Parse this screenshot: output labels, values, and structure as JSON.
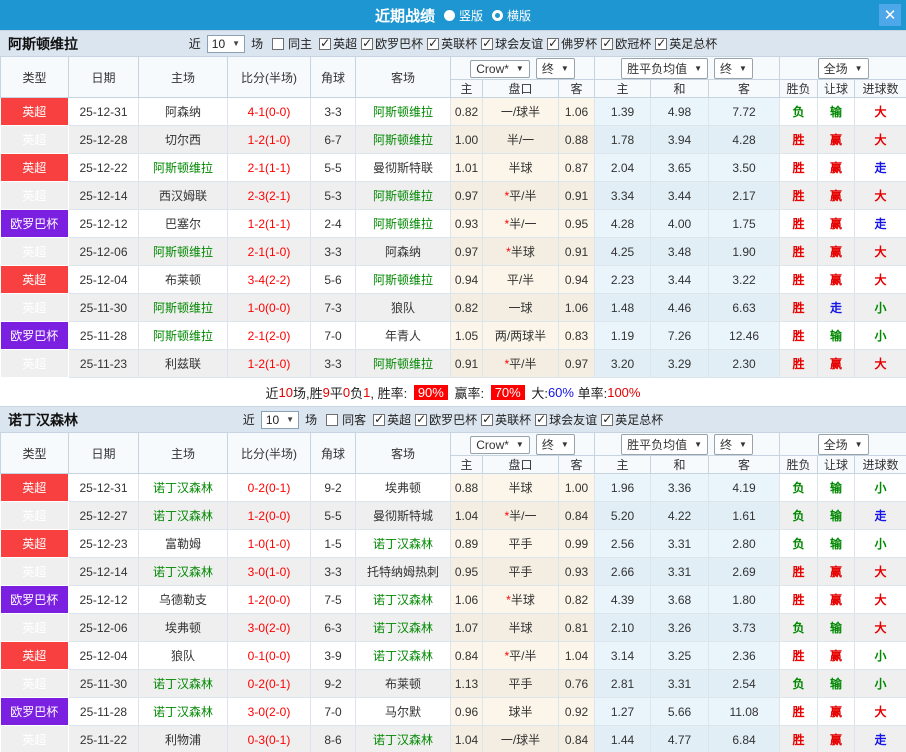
{
  "titlebar": {
    "title": "近期战绩",
    "modes": [
      {
        "label": "竖版",
        "selected": false
      },
      {
        "label": "横版",
        "selected": true
      }
    ],
    "close_icon": "✕"
  },
  "colors": {
    "titlebar_blue": "#1e96d2",
    "epl_badge_red": "#f84040",
    "europa_badge_purple": "#7b1fe0",
    "team_highlight_green": "#008800",
    "score_red": "#ff0000",
    "win_red": "#e60000",
    "lose_green": "#008800",
    "draw_blue": "#1414e6",
    "rate_badge_red": "#ff0000"
  },
  "table_header": {
    "cols": [
      "类型",
      "日期",
      "主场",
      "比分(半场)",
      "角球",
      "客场"
    ],
    "bookmaker": "Crow*",
    "final1": "终",
    "avg_label": "胜平负均值",
    "final2": "终",
    "scope": "全场",
    "sub": [
      "主",
      "盘口",
      "客",
      "主",
      "和",
      "客",
      "胜负",
      "让球",
      "进球数"
    ]
  },
  "sections": [
    {
      "team": "阿斯顿维拉",
      "filter": {
        "near_label": "近",
        "count": "10",
        "unit_label": "场",
        "same_label": "同主",
        "same_checked": false,
        "leagues": [
          {
            "label": "英超",
            "checked": true
          },
          {
            "label": "欧罗巴杯",
            "checked": true
          },
          {
            "label": "英联杯",
            "checked": true
          },
          {
            "label": "球会友谊",
            "checked": true
          },
          {
            "label": "佛罗杯",
            "checked": true
          },
          {
            "label": "欧冠杯",
            "checked": true
          },
          {
            "label": "英足总杯",
            "checked": true
          }
        ]
      },
      "rows": [
        {
          "league": "英超",
          "lg": "red",
          "date": "25-12-31",
          "home": "阿森纳",
          "home_hl": false,
          "score": "4-1(0-0)",
          "corner": "3-3",
          "away": "阿斯顿维拉",
          "away_hl": true,
          "h": "0.82",
          "star": false,
          "hcap": "一/球半",
          "a": "1.06",
          "m1": "1.39",
          "m2": "4.98",
          "m3": "7.72",
          "r1": "负",
          "c1": "green",
          "r2": "输",
          "c2": "green",
          "r3": "大",
          "c3": "red"
        },
        {
          "league": "英超",
          "lg": "red",
          "date": "25-12-28",
          "home": "切尔西",
          "home_hl": false,
          "score": "1-2(1-0)",
          "corner": "6-7",
          "away": "阿斯顿维拉",
          "away_hl": true,
          "h": "1.00",
          "star": false,
          "hcap": "半/一",
          "a": "0.88",
          "m1": "1.78",
          "m2": "3.94",
          "m3": "4.28",
          "r1": "胜",
          "c1": "red",
          "r2": "赢",
          "c2": "red",
          "r3": "大",
          "c3": "red"
        },
        {
          "league": "英超",
          "lg": "red",
          "date": "25-12-22",
          "home": "阿斯顿维拉",
          "home_hl": true,
          "score": "2-1(1-1)",
          "corner": "5-5",
          "away": "曼彻斯特联",
          "away_hl": false,
          "h": "1.01",
          "star": false,
          "hcap": "半球",
          "a": "0.87",
          "m1": "2.04",
          "m2": "3.65",
          "m3": "3.50",
          "r1": "胜",
          "c1": "red",
          "r2": "赢",
          "c2": "red",
          "r3": "走",
          "c3": "blue"
        },
        {
          "league": "英超",
          "lg": "red",
          "date": "25-12-14",
          "home": "西汉姆联",
          "home_hl": false,
          "score": "2-3(2-1)",
          "corner": "5-3",
          "away": "阿斯顿维拉",
          "away_hl": true,
          "h": "0.97",
          "star": true,
          "hcap": "平/半",
          "a": "0.91",
          "m1": "3.34",
          "m2": "3.44",
          "m3": "2.17",
          "r1": "胜",
          "c1": "red",
          "r2": "赢",
          "c2": "red",
          "r3": "大",
          "c3": "red"
        },
        {
          "league": "欧罗巴杯",
          "lg": "purple",
          "date": "25-12-12",
          "home": "巴塞尔",
          "home_hl": false,
          "score": "1-2(1-1)",
          "corner": "2-4",
          "away": "阿斯顿维拉",
          "away_hl": true,
          "h": "0.93",
          "star": true,
          "hcap": "半/一",
          "a": "0.95",
          "m1": "4.28",
          "m2": "4.00",
          "m3": "1.75",
          "r1": "胜",
          "c1": "red",
          "r2": "赢",
          "c2": "red",
          "r3": "走",
          "c3": "blue"
        },
        {
          "league": "英超",
          "lg": "red",
          "date": "25-12-06",
          "home": "阿斯顿维拉",
          "home_hl": true,
          "score": "2-1(1-0)",
          "corner": "3-3",
          "away": "阿森纳",
          "away_hl": false,
          "h": "0.97",
          "star": true,
          "hcap": "半球",
          "a": "0.91",
          "m1": "4.25",
          "m2": "3.48",
          "m3": "1.90",
          "r1": "胜",
          "c1": "red",
          "r2": "赢",
          "c2": "red",
          "r3": "大",
          "c3": "red"
        },
        {
          "league": "英超",
          "lg": "red",
          "date": "25-12-04",
          "home": "布莱顿",
          "home_hl": false,
          "score": "3-4(2-2)",
          "corner": "5-6",
          "away": "阿斯顿维拉",
          "away_hl": true,
          "h": "0.94",
          "star": false,
          "hcap": "平/半",
          "a": "0.94",
          "m1": "2.23",
          "m2": "3.44",
          "m3": "3.22",
          "r1": "胜",
          "c1": "red",
          "r2": "赢",
          "c2": "red",
          "r3": "大",
          "c3": "red"
        },
        {
          "league": "英超",
          "lg": "red",
          "date": "25-11-30",
          "home": "阿斯顿维拉",
          "home_hl": true,
          "score": "1-0(0-0)",
          "corner": "7-3",
          "away": "狼队",
          "away_hl": false,
          "h": "0.82",
          "star": false,
          "hcap": "一球",
          "a": "1.06",
          "m1": "1.48",
          "m2": "4.46",
          "m3": "6.63",
          "r1": "胜",
          "c1": "red",
          "r2": "走",
          "c2": "blue",
          "r3": "小",
          "c3": "green"
        },
        {
          "league": "欧罗巴杯",
          "lg": "purple",
          "date": "25-11-28",
          "home": "阿斯顿维拉",
          "home_hl": true,
          "score": "2-1(2-0)",
          "corner": "7-0",
          "away": "年青人",
          "away_hl": false,
          "h": "1.05",
          "star": false,
          "hcap": "两/两球半",
          "a": "0.83",
          "m1": "1.19",
          "m2": "7.26",
          "m3": "12.46",
          "r1": "胜",
          "c1": "red",
          "r2": "输",
          "c2": "green",
          "r3": "小",
          "c3": "green"
        },
        {
          "league": "英超",
          "lg": "red",
          "date": "25-11-23",
          "home": "利兹联",
          "home_hl": false,
          "score": "1-2(1-0)",
          "corner": "3-3",
          "away": "阿斯顿维拉",
          "away_hl": true,
          "h": "0.91",
          "star": true,
          "hcap": "平/半",
          "a": "0.97",
          "m1": "3.20",
          "m2": "3.29",
          "m3": "2.30",
          "r1": "胜",
          "c1": "red",
          "r2": "赢",
          "c2": "red",
          "r3": "大",
          "c3": "red"
        }
      ],
      "summary_segments": [
        {
          "t": "近"
        },
        {
          "t": "10",
          "c": "red"
        },
        {
          "t": "场,胜"
        },
        {
          "t": "9",
          "c": "red"
        },
        {
          "t": "平"
        },
        {
          "t": "0",
          "c": "red"
        },
        {
          "t": "负"
        },
        {
          "t": "1",
          "c": "red"
        },
        {
          "t": ", 胜率: "
        },
        {
          "t": "90%",
          "badge": true
        },
        {
          "t": " 赢率: "
        },
        {
          "t": "70%",
          "badge": true
        },
        {
          "t": " 大:"
        },
        {
          "t": "60%",
          "c": "blue"
        },
        {
          "t": " 单率:"
        },
        {
          "t": "100%",
          "c": "red"
        }
      ]
    },
    {
      "team": "诺丁汉森林",
      "filter": {
        "near_label": "近",
        "count": "10",
        "unit_label": "场",
        "same_label": "同客",
        "same_checked": false,
        "leagues": [
          {
            "label": "英超",
            "checked": true
          },
          {
            "label": "欧罗巴杯",
            "checked": true
          },
          {
            "label": "英联杯",
            "checked": true
          },
          {
            "label": "球会友谊",
            "checked": true
          },
          {
            "label": "英足总杯",
            "checked": true
          }
        ]
      },
      "rows": [
        {
          "league": "英超",
          "lg": "red",
          "date": "25-12-31",
          "home": "诺丁汉森林",
          "home_hl": true,
          "score": "0-2(0-1)",
          "corner": "9-2",
          "away": "埃弗顿",
          "away_hl": false,
          "h": "0.88",
          "star": false,
          "hcap": "半球",
          "a": "1.00",
          "m1": "1.96",
          "m2": "3.36",
          "m3": "4.19",
          "r1": "负",
          "c1": "green",
          "r2": "输",
          "c2": "green",
          "r3": "小",
          "c3": "green"
        },
        {
          "league": "英超",
          "lg": "red",
          "date": "25-12-27",
          "home": "诺丁汉森林",
          "home_hl": true,
          "score": "1-2(0-0)",
          "corner": "5-5",
          "away": "曼彻斯特城",
          "away_hl": false,
          "h": "1.04",
          "star": true,
          "hcap": "半/一",
          "a": "0.84",
          "m1": "5.20",
          "m2": "4.22",
          "m3": "1.61",
          "r1": "负",
          "c1": "green",
          "r2": "输",
          "c2": "green",
          "r3": "走",
          "c3": "blue"
        },
        {
          "league": "英超",
          "lg": "red",
          "date": "25-12-23",
          "home": "富勒姆",
          "home_hl": false,
          "score": "1-0(1-0)",
          "corner": "1-5",
          "away": "诺丁汉森林",
          "away_hl": true,
          "h": "0.89",
          "star": false,
          "hcap": "平手",
          "a": "0.99",
          "m1": "2.56",
          "m2": "3.31",
          "m3": "2.80",
          "r1": "负",
          "c1": "green",
          "r2": "输",
          "c2": "green",
          "r3": "小",
          "c3": "green"
        },
        {
          "league": "英超",
          "lg": "red",
          "date": "25-12-14",
          "home": "诺丁汉森林",
          "home_hl": true,
          "score": "3-0(1-0)",
          "corner": "3-3",
          "away": "托特纳姆热刺",
          "away_hl": false,
          "h": "0.95",
          "star": false,
          "hcap": "平手",
          "a": "0.93",
          "m1": "2.66",
          "m2": "3.31",
          "m3": "2.69",
          "r1": "胜",
          "c1": "red",
          "r2": "赢",
          "c2": "red",
          "r3": "大",
          "c3": "red"
        },
        {
          "league": "欧罗巴杯",
          "lg": "purple",
          "date": "25-12-12",
          "home": "乌德勒支",
          "home_hl": false,
          "score": "1-2(0-0)",
          "corner": "7-5",
          "away": "诺丁汉森林",
          "away_hl": true,
          "h": "1.06",
          "star": true,
          "hcap": "半球",
          "a": "0.82",
          "m1": "4.39",
          "m2": "3.68",
          "m3": "1.80",
          "r1": "胜",
          "c1": "red",
          "r2": "赢",
          "c2": "red",
          "r3": "大",
          "c3": "red"
        },
        {
          "league": "英超",
          "lg": "red",
          "date": "25-12-06",
          "home": "埃弗顿",
          "home_hl": false,
          "score": "3-0(2-0)",
          "corner": "6-3",
          "away": "诺丁汉森林",
          "away_hl": true,
          "h": "1.07",
          "star": false,
          "hcap": "半球",
          "a": "0.81",
          "m1": "2.10",
          "m2": "3.26",
          "m3": "3.73",
          "r1": "负",
          "c1": "green",
          "r2": "输",
          "c2": "green",
          "r3": "大",
          "c3": "red"
        },
        {
          "league": "英超",
          "lg": "red",
          "date": "25-12-04",
          "home": "狼队",
          "home_hl": false,
          "score": "0-1(0-0)",
          "corner": "3-9",
          "away": "诺丁汉森林",
          "away_hl": true,
          "h": "0.84",
          "star": true,
          "hcap": "平/半",
          "a": "1.04",
          "m1": "3.14",
          "m2": "3.25",
          "m3": "2.36",
          "r1": "胜",
          "c1": "red",
          "r2": "赢",
          "c2": "red",
          "r3": "小",
          "c3": "green"
        },
        {
          "league": "英超",
          "lg": "red",
          "date": "25-11-30",
          "home": "诺丁汉森林",
          "home_hl": true,
          "score": "0-2(0-1)",
          "corner": "9-2",
          "away": "布莱顿",
          "away_hl": false,
          "h": "1.13",
          "star": false,
          "hcap": "平手",
          "a": "0.76",
          "m1": "2.81",
          "m2": "3.31",
          "m3": "2.54",
          "r1": "负",
          "c1": "green",
          "r2": "输",
          "c2": "green",
          "r3": "小",
          "c3": "green"
        },
        {
          "league": "欧罗巴杯",
          "lg": "purple",
          "date": "25-11-28",
          "home": "诺丁汉森林",
          "home_hl": true,
          "score": "3-0(2-0)",
          "corner": "7-0",
          "away": "马尔默",
          "away_hl": false,
          "h": "0.96",
          "star": false,
          "hcap": "球半",
          "a": "0.92",
          "m1": "1.27",
          "m2": "5.66",
          "m3": "11.08",
          "r1": "胜",
          "c1": "red",
          "r2": "赢",
          "c2": "red",
          "r3": "大",
          "c3": "red"
        },
        {
          "league": "英超",
          "lg": "red",
          "date": "25-11-22",
          "home": "利物浦",
          "home_hl": false,
          "score": "0-3(0-1)",
          "corner": "8-6",
          "away": "诺丁汉森林",
          "away_hl": true,
          "h": "1.04",
          "star": false,
          "hcap": "一/球半",
          "a": "0.84",
          "m1": "1.44",
          "m2": "4.77",
          "m3": "6.84",
          "r1": "胜",
          "c1": "red",
          "r2": "赢",
          "c2": "red",
          "r3": "走",
          "c3": "blue"
        }
      ]
    }
  ]
}
